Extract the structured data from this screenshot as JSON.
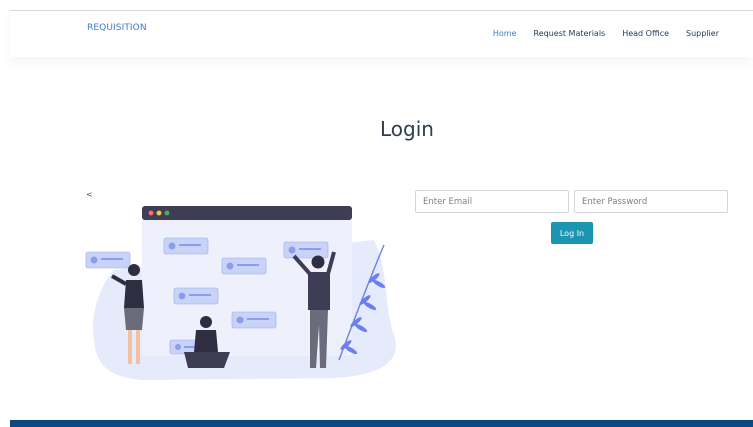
{
  "navbar": {
    "brand": "REQUISITION",
    "links": [
      {
        "label": "Home",
        "active": true
      },
      {
        "label": "Request Materials",
        "active": false
      },
      {
        "label": "Head Office",
        "active": false
      },
      {
        "label": "Supplier",
        "active": false
      }
    ]
  },
  "main": {
    "title": "Login",
    "back_glyph": "<"
  },
  "form": {
    "email_placeholder": "Enter Email",
    "password_placeholder": "Enter Password",
    "submit_label": "Log In"
  },
  "colors": {
    "brand": "#3c7cc6",
    "nav_text": "#1f3a57",
    "button": "#1b95b1",
    "footer": "#0d4780",
    "illustration_bg": "#e6ebfb",
    "illustration_accent": "#6c7ff0"
  },
  "icons": {
    "illustration": "team-collaboration-illustration"
  }
}
